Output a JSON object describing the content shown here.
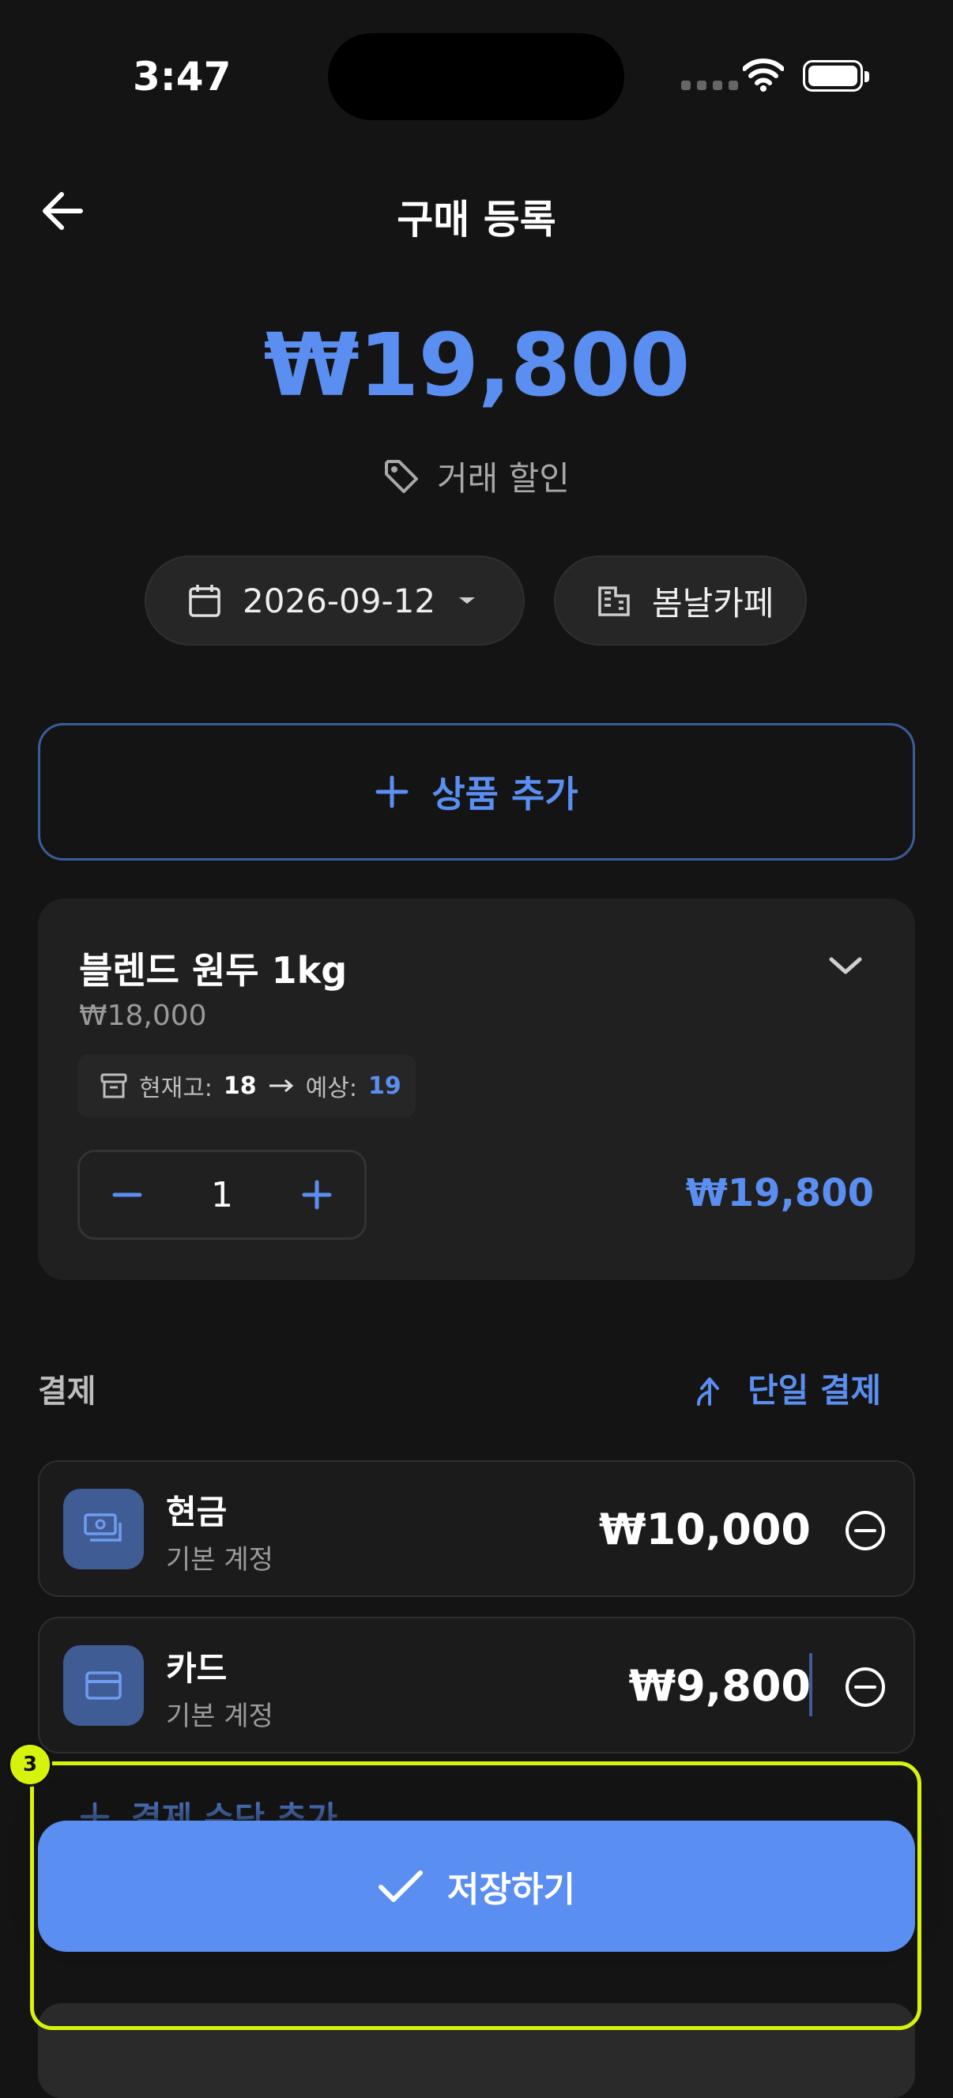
{
  "status_bar": {
    "time": "3:47"
  },
  "header": {
    "title": "구매 등록"
  },
  "total": "₩19,800",
  "discount_label": "거래 할인",
  "date": "2026-09-12",
  "store": "봄날카페",
  "add_product_label": "상품 추가",
  "product": {
    "name": "블렌드 원두 1kg",
    "price": "₩18,000",
    "stock_label": "현재고:",
    "stock_value": "18",
    "expected_label": "예상:",
    "expected_value": "19",
    "quantity": "1",
    "line_total": "₩19,800"
  },
  "payment": {
    "section_label": "결제",
    "single_pay_label": "단일 결제",
    "methods": [
      {
        "name": "현금",
        "account": "기본 계정",
        "amount": "₩10,000"
      },
      {
        "name": "카드",
        "account": "기본 계정",
        "amount": "₩9,800"
      }
    ],
    "add_method_label": "결제 수단 추가"
  },
  "save_label": "저장하기",
  "highlight_badge": "3",
  "colors": {
    "accent": "#5a8ef0",
    "background": "#141414",
    "highlight": "#d7f20c"
  }
}
